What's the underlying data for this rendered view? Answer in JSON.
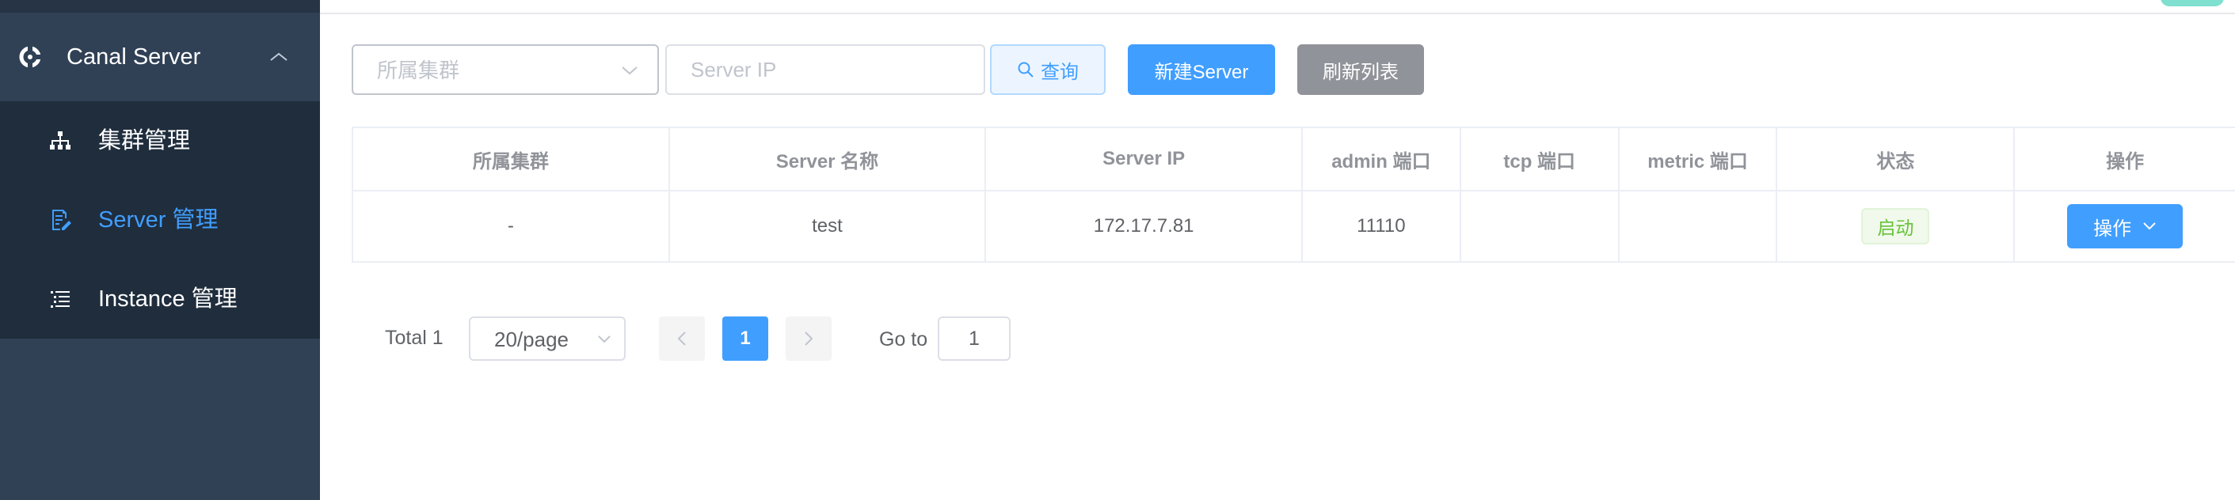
{
  "sidebar": {
    "group_label": "Canal Server",
    "items": [
      {
        "label": "集群管理",
        "icon": "cluster-tree-icon",
        "active": false
      },
      {
        "label": "Server 管理",
        "icon": "server-doc-icon",
        "active": true
      },
      {
        "label": "Instance 管理",
        "icon": "list-icon",
        "active": false
      }
    ]
  },
  "filters": {
    "cluster_placeholder": "所属集群",
    "ip_placeholder": "Server IP",
    "query_label": "查询",
    "new_label": "新建Server",
    "refresh_label": "刷新列表"
  },
  "table": {
    "headers": [
      "所属集群",
      "Server 名称",
      "Server IP",
      "admin 端口",
      "tcp 端口",
      "metric 端口",
      "状态",
      "操作"
    ],
    "rows": [
      {
        "cluster": "-",
        "name": "test",
        "ip": "172.17.7.81",
        "admin_port": "11110",
        "tcp_port": "",
        "metric_port": "",
        "status": "启动",
        "action": "操作"
      }
    ]
  },
  "pagination": {
    "total": "Total 1",
    "page_size": "20/page",
    "current_page": "1",
    "goto_label": "Go to",
    "goto_value": "1"
  },
  "colors": {
    "sidebar_bg": "#304156",
    "submenu_bg": "#1f2d3d",
    "primary": "#409eff",
    "success": "#67c23a",
    "info": "#909399"
  }
}
